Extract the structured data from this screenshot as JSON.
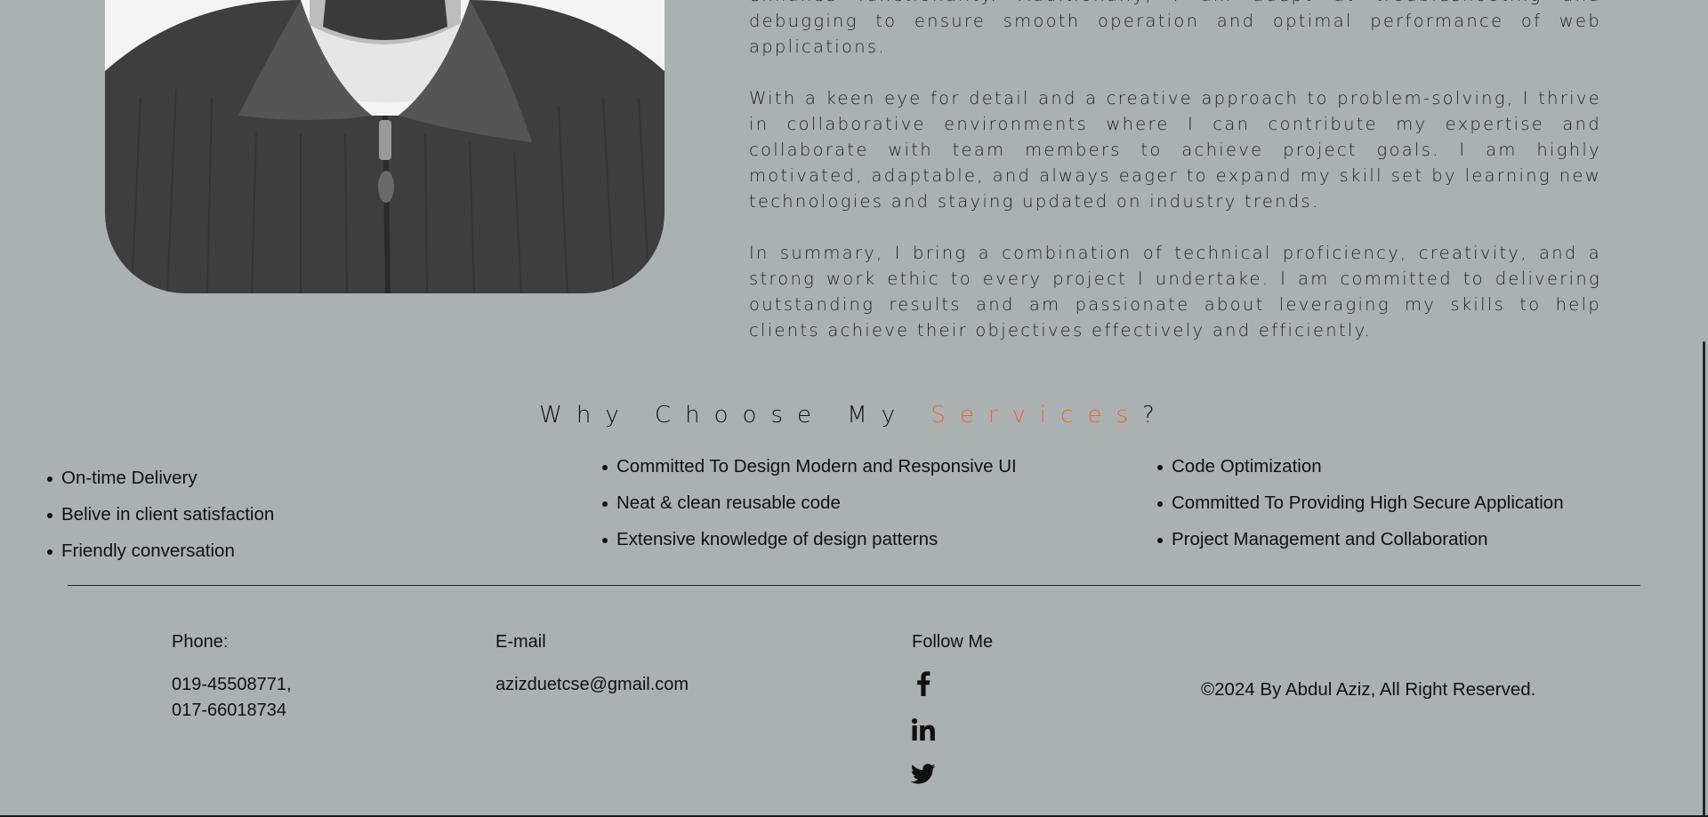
{
  "about": {
    "paragraphs": [
      "enhance functionality. Additionally, I am adept at troubleshooting and debugging to ensure smooth operation and optimal performance of web applications.",
      "With a keen eye for detail and a creative approach to problem-solving, I thrive in collaborative environments where I can contribute my expertise and collaborate with team members to achieve project goals. I am highly motivated, adaptable, and always eager to expand my skill set by learning new technologies and staying updated on industry trends.",
      "In summary, I bring a combination of technical proficiency, creativity, and a strong work ethic to every project I undertake. I am committed to delivering outstanding results and am passionate about leveraging my skills to help clients achieve their objectives effectively and efficiently."
    ]
  },
  "why": {
    "heading_prefix": "Why Choose My ",
    "heading_accent": "Services",
    "heading_suffix": "?",
    "accent_color": "#e4692e",
    "columns": [
      [
        "On-time Delivery",
        "Belive in client satisfaction",
        "Friendly conversation"
      ],
      [
        "Committed To Design Modern and Responsive UI",
        "Neat & clean reusable code",
        "Extensive knowledge of design patterns"
      ],
      [
        "Code Optimization",
        "Committed To Providing High Secure Application",
        "Project Management and Collaboration"
      ]
    ]
  },
  "footer": {
    "phone_label": "Phone:",
    "phone_line1": "019-45508771,",
    "phone_line2": "017-66018734",
    "email_label": "E-mail",
    "email_value": "azizduetcse@gmail.com",
    "follow_label": "Follow Me",
    "social_icons": [
      "facebook-icon",
      "linkedin-icon",
      "twitter-icon"
    ],
    "copyright": "©2024 By Abdul Aziz, All Right Reserved."
  },
  "colors": {
    "background": "#abb1b1",
    "accent": "#e4692e",
    "text": "#111111"
  }
}
